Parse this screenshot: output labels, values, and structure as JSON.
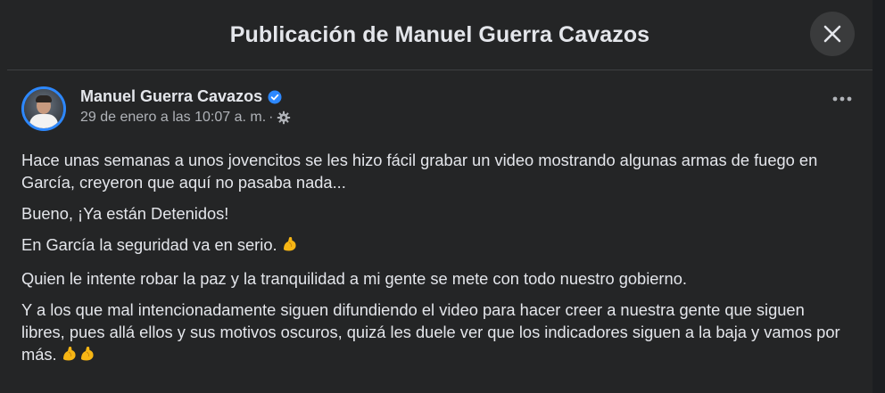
{
  "dialog": {
    "title": "Publicación de Manuel Guerra Cavazos",
    "close_icon": "close-icon"
  },
  "post": {
    "author": "Manuel Guerra Cavazos",
    "verified_icon": "verified-badge-icon",
    "date": "29 de enero a las 10:07 a. m.",
    "separator": "·",
    "privacy_icon": "gear-icon",
    "more_icon": "more-options-icon",
    "paragraphs": [
      "Hace unas semanas a unos jovencitos se les hizo fácil grabar un video mostrando algunas armas de fuego en García, creyeron que aquí no pasaba nada...",
      "Bueno, ¡Ya están Detenidos!",
      "En García la seguridad va en serio.",
      "Quien le intente robar la paz y la tranquilidad a mi gente se mete con todo nuestro gobierno.",
      "Y a los que mal intencionadamente siguen difundiendo el video para hacer creer a nuestra gente que siguen libres, pues allá ellos y sus motivos oscuros, quizá les duele ver que los indicadores siguen a la baja y vamos por más."
    ],
    "emoji_icon": "flexed-biceps-icon"
  },
  "colors": {
    "background": "#18191a",
    "card": "#242526",
    "text_primary": "#e4e6eb",
    "text_secondary": "#b0b3b8",
    "accent": "#2d88ff"
  }
}
